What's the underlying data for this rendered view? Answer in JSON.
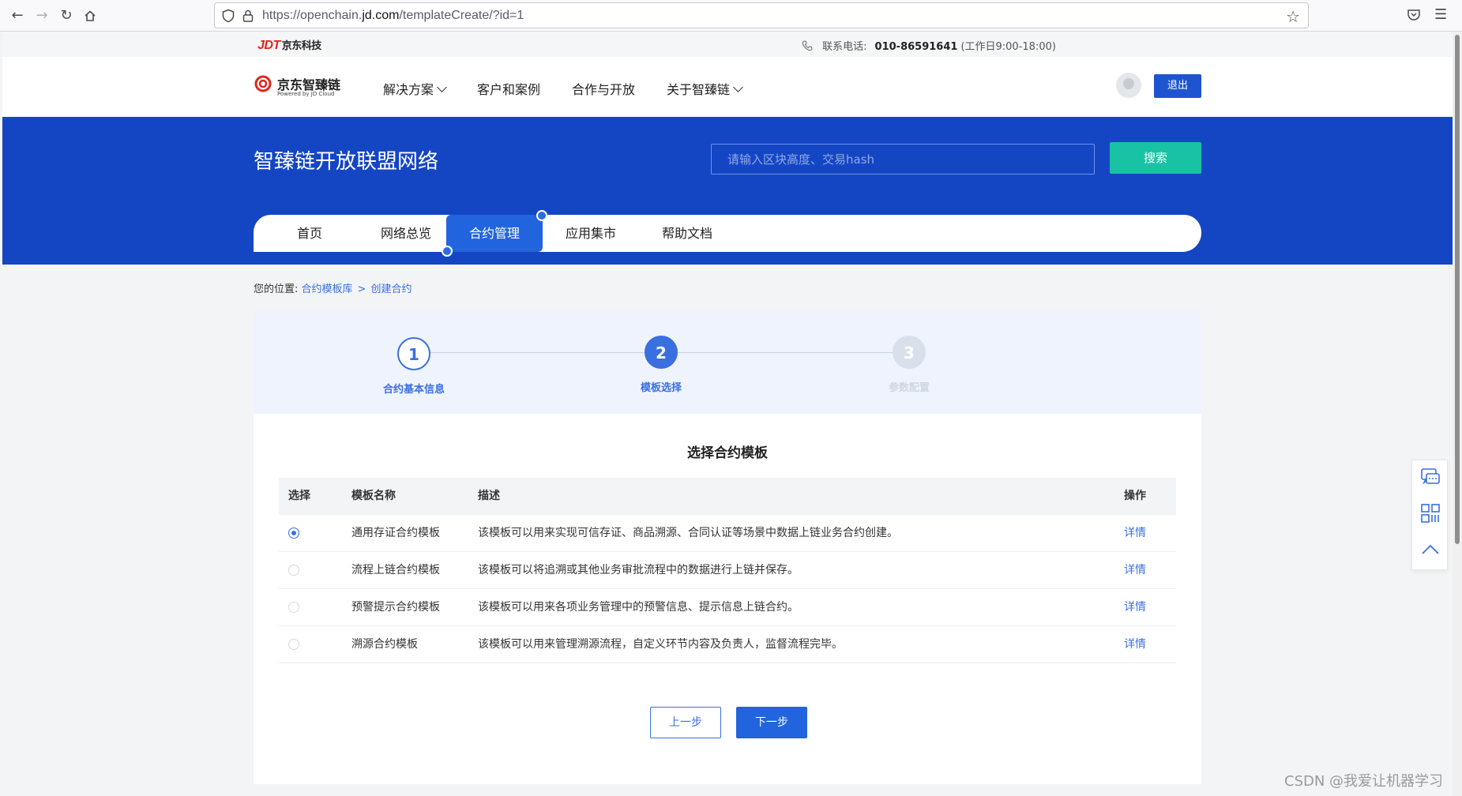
{
  "browser": {
    "url_prefix": "https://openchain.",
    "url_domain": "jd.com",
    "url_path": "/templateCreate/?id=1"
  },
  "topbar": {
    "jdt_logo": "JDT",
    "jdt_logo_cn": "京东科技",
    "contact_label": "联系电话:",
    "contact_number": "010-86591641",
    "contact_hours": "(工作日9:00-18:00)"
  },
  "header": {
    "brand_name": "京东智臻链",
    "brand_sub": "Powered by JD Cloud",
    "nav": [
      {
        "label": "解决方案",
        "dropdown": true
      },
      {
        "label": "客户和案例",
        "dropdown": false
      },
      {
        "label": "合作与开放",
        "dropdown": false
      },
      {
        "label": "关于智臻链",
        "dropdown": true
      }
    ],
    "logout_label": "退出"
  },
  "banner": {
    "title": "智臻链开放联盟网络",
    "search_placeholder": "请输入区块高度、交易hash",
    "search_label": "搜索",
    "tabs": [
      "首页",
      "网络总览",
      "合约管理",
      "应用集市",
      "帮助文档"
    ],
    "active_tab": 2
  },
  "breadcrumb": {
    "prefix": "您的位置:",
    "items": [
      "合约模板库",
      "创建合约"
    ],
    "separator": ">"
  },
  "steps": {
    "items": [
      {
        "number": "1",
        "label": "合约基本信息",
        "state": "done"
      },
      {
        "number": "2",
        "label": "模板选择",
        "state": "current"
      },
      {
        "number": "3",
        "label": "参数配置",
        "state": "todo"
      }
    ]
  },
  "section": {
    "title": "选择合约模板"
  },
  "table": {
    "headers": {
      "select": "选择",
      "name": "模板名称",
      "desc": "描述",
      "op": "操作"
    },
    "rows": [
      {
        "name": "通用存证合约模板",
        "desc": "该模板可以用来实现可信存证、商品溯源、合同认证等场景中数据上链业务合约创建。",
        "op": "详情",
        "selected": true
      },
      {
        "name": "流程上链合约模板",
        "desc": "该模板可以将追溯或其他业务审批流程中的数据进行上链并保存。",
        "op": "详情",
        "selected": false
      },
      {
        "name": "预警提示合约模板",
        "desc": "该模板可以用来各项业务管理中的预警信息、提示信息上链合约。",
        "op": "详情",
        "selected": false
      },
      {
        "name": "溯源合约模板",
        "desc": "该模板可以用来管理溯源流程，自定义环节内容及负责人，监督流程完毕。",
        "op": "详情",
        "selected": false
      }
    ]
  },
  "actions": {
    "prev_label": "上一步",
    "next_label": "下一步"
  },
  "watermark": "CSDN @我爱让机器学习",
  "colors": {
    "primary": "#2264dd",
    "banner": "#1446c4",
    "search_button": "#19c2a4",
    "link": "#3a6fe0"
  }
}
